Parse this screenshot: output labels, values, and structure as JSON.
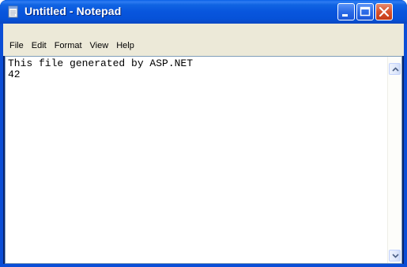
{
  "window": {
    "title": "Untitled - Notepad"
  },
  "menu": {
    "items": [
      "File",
      "Edit",
      "Format",
      "View",
      "Help"
    ]
  },
  "editor": {
    "content": "This file generated by ASP.NET\n42"
  },
  "icons": {
    "app": "notepad-icon",
    "minimize": "minimize-icon",
    "maximize": "maximize-icon",
    "close": "close-icon",
    "scroll_up": "scroll-up-arrow-icon",
    "scroll_down": "scroll-down-arrow-icon"
  },
  "colors": {
    "titlebar": "#0855dd",
    "close_button": "#d8522c",
    "menubar": "#ece9d8",
    "editor_background": "#ffffff"
  }
}
